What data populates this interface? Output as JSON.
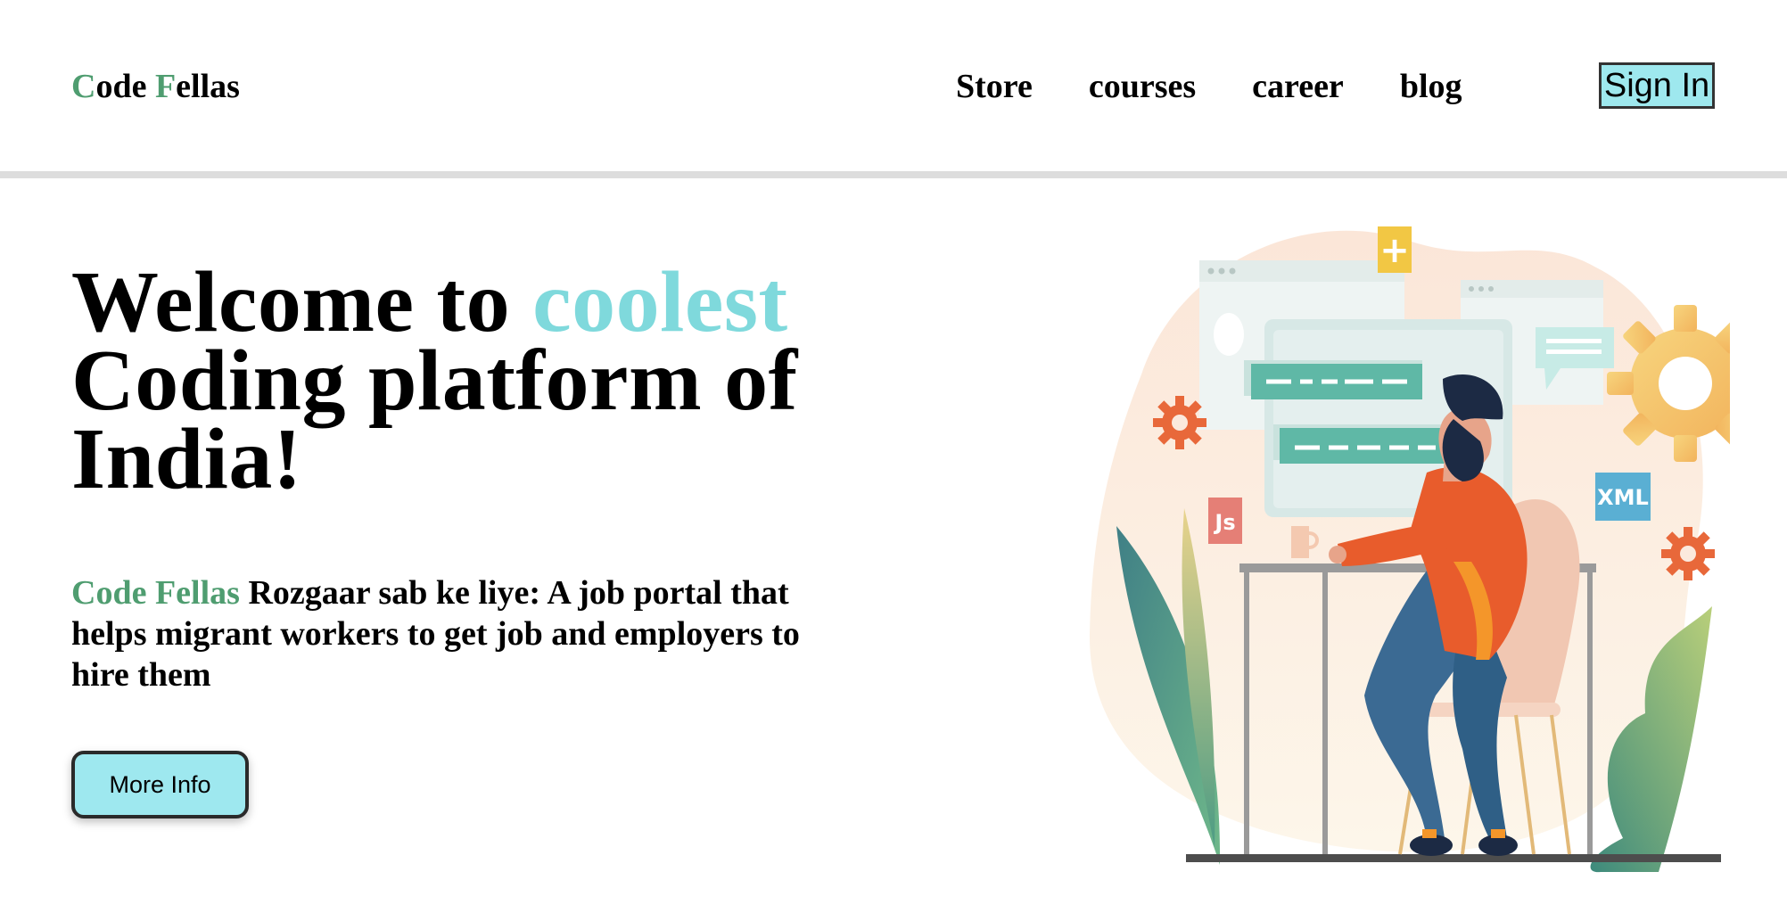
{
  "header": {
    "logo": {
      "c1": "C",
      "r1": "ode ",
      "c2": "F",
      "r2": "ellas"
    },
    "nav": [
      "Store",
      "courses",
      "career",
      "blog"
    ],
    "signin_label": "Sign In"
  },
  "hero": {
    "title_a": "Welcome to ",
    "title_highlight": "coolest",
    "title_b": " Coding platform of India!",
    "brand": "Code Fellas",
    "description": " Rozgaar sab ke liye: A job portal that helps migrant workers to get job and employers to hire them",
    "button_label": "More Info"
  },
  "illustration": {
    "badge_js": "Js",
    "badge_xml": "XML",
    "badge_plus": "+"
  },
  "colors": {
    "accent_green": "#4f9d70",
    "accent_cyan": "#7fd9dc",
    "button_bg": "#9ee8ef",
    "divider": "#dddddd"
  }
}
